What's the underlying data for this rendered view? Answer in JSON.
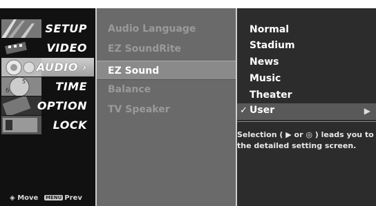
{
  "menu": {
    "items": [
      {
        "label": "SETUP",
        "icon": "setup-thumbnail-icon"
      },
      {
        "label": "VIDEO",
        "icon": "video-thumbnail-icon"
      },
      {
        "label": "AUDIO",
        "icon": "audio-thumbnail-icon",
        "selected": true,
        "arrow": "›"
      },
      {
        "label": "TIME",
        "icon": "time-thumbnail-icon"
      },
      {
        "label": "OPTION",
        "icon": "option-thumbnail-icon"
      },
      {
        "label": "LOCK",
        "icon": "lock-thumbnail-icon"
      }
    ],
    "hints": {
      "move": "Move",
      "menu_key": "MENU",
      "prev": "Prev"
    }
  },
  "audio": {
    "options": [
      {
        "label": "Audio Language"
      },
      {
        "label": "EZ SoundRite"
      },
      {
        "label": "EZ Sound",
        "selected": true
      },
      {
        "label": "Balance"
      },
      {
        "label": "TV Speaker"
      }
    ]
  },
  "ez_sound": {
    "choices": [
      "Normal",
      "Stadium",
      "News",
      "Music",
      "Theater"
    ],
    "user": {
      "label": "User",
      "check": "✓",
      "arrow": "▶"
    },
    "description": "Selection ( ▶ or ◎ ) leads you to the detailed setting screen."
  },
  "colors": {
    "left_bg": "#111111",
    "middle_bg": "#6a6a6a",
    "right_bg": "#2c2c2c",
    "selected_row": "#8a8a8a"
  }
}
